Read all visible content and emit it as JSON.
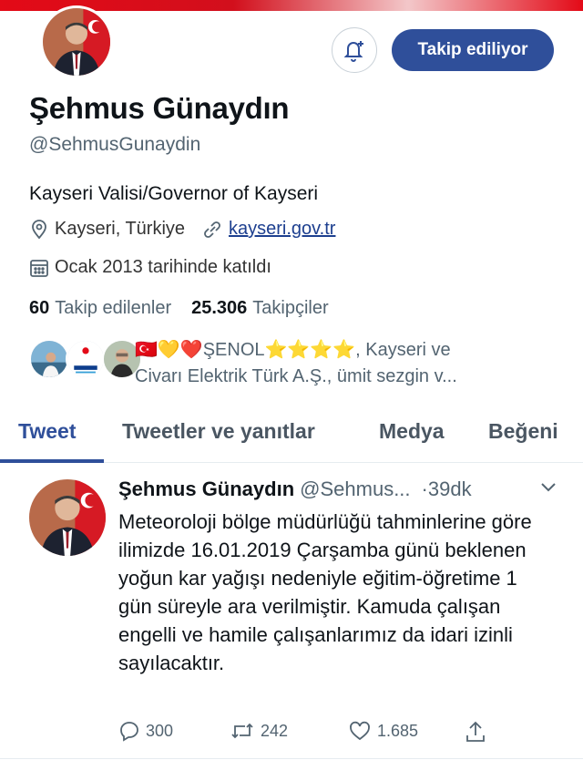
{
  "profile": {
    "name": "Şehmus Günaydın",
    "handle": "@SehmusGunaydin",
    "bio": "Kayseri Valisi/Governor of Kayseri",
    "location": "Kayseri, Türkiye",
    "website": "kayseri.gov.tr",
    "joined": "Ocak 2013 tarihinde katıldı",
    "following_count": "60",
    "following_label": "Takip edilenler",
    "followers_count": "25.306",
    "followers_label": "Takipçiler",
    "follow_button_label": "Takip ediliyor"
  },
  "mutuals": {
    "text_line1": "🇹🇷💛❤️ŞENOL⭐⭐⭐⭐, Kayseri ve",
    "text_line2": "Civarı Elektrik Türk A.Ş., ümit sezgin v..."
  },
  "tabs": [
    {
      "label": "Tweet"
    },
    {
      "label": "Tweetler ve yanıtlar"
    },
    {
      "label": "Medya"
    },
    {
      "label": "Beğeni"
    }
  ],
  "tweet": {
    "author_name": "Şehmus Günaydın",
    "author_handle": "@Sehmus...",
    "time": "·39dk",
    "text": "Meteoroloji bölge müdürlüğü tahminlerine göre ilimizde 16.01.2019 Çarşamba günü beklenen yoğun kar yağışı nedeniyle eğitim-öğretime 1 gün süreyle ara verilmiştir. Kamuda çalışan engelli ve hamile çalışanlarımız da idari izinli sayılacaktır.",
    "replies": "300",
    "retweets": "242",
    "likes": "1.685"
  },
  "colors": {
    "accent": "#2f4f9a",
    "muted": "#536471"
  }
}
